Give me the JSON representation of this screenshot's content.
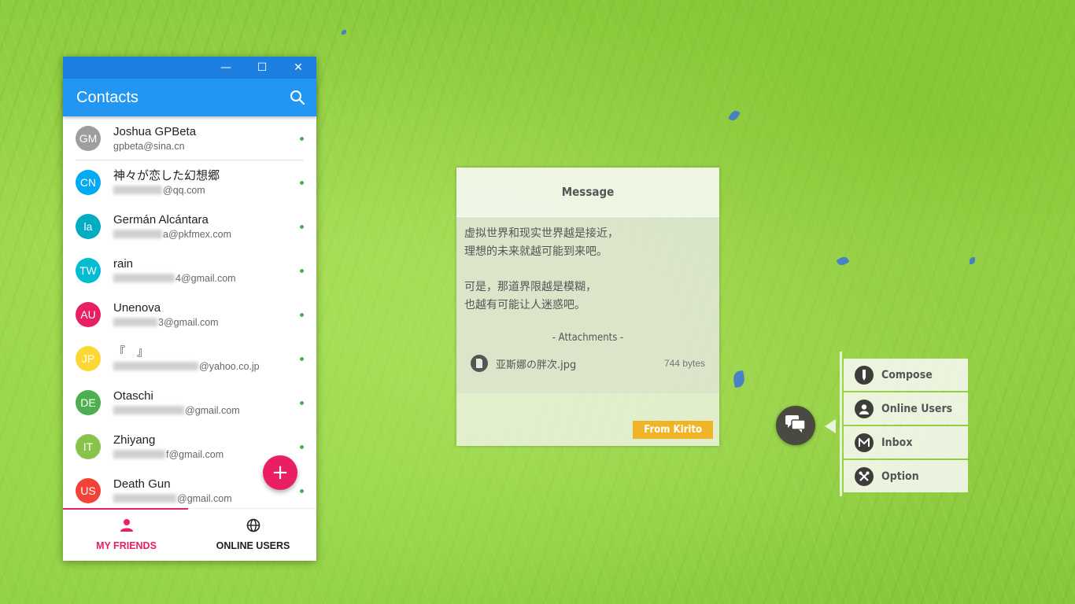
{
  "contacts_window": {
    "window_controls": {
      "minimize": "—",
      "maximize": "☐",
      "close": "✕"
    },
    "title": "Contacts",
    "contacts": [
      {
        "initials": "GM",
        "name": "Joshua GPBeta",
        "email": "gpbeta@sina.cn",
        "color": "#9e9e9e",
        "online": true
      },
      {
        "initials": "CN",
        "name": "神々が恋した幻想郷",
        "email": "@qq.com",
        "color": "#03a9f4",
        "online": true
      },
      {
        "initials": "la",
        "name": "Germán Alcántara",
        "email": "a@pkfmex.com",
        "color": "#00acc1",
        "online": true
      },
      {
        "initials": "TW",
        "name": "rain",
        "email": "4@gmail.com",
        "color": "#00bcd4",
        "online": true
      },
      {
        "initials": "AU",
        "name": "Unenova",
        "email": "3@gmail.com",
        "color": "#e91e63",
        "online": true
      },
      {
        "initials": "JP",
        "name": "『　』",
        "email": "@yahoo.co.jp",
        "color": "#fdd835",
        "online": true
      },
      {
        "initials": "DE",
        "name": "Otaschi",
        "email": "@gmail.com",
        "color": "#4caf50",
        "online": true
      },
      {
        "initials": "IT",
        "name": "Zhiyang",
        "email": "f@gmail.com",
        "color": "#8bc34a",
        "online": true
      },
      {
        "initials": "US",
        "name": "Death Gun",
        "email": "@gmail.com",
        "color": "#f44336",
        "online": true
      }
    ],
    "fab_label": "+",
    "nav": [
      {
        "label": "MY FRIENDS",
        "icon": "person-icon",
        "active": true,
        "color": "#e91e63"
      },
      {
        "label": "ONLINE USERS",
        "icon": "globe-icon",
        "active": false,
        "color": "#222222"
      }
    ]
  },
  "message_card": {
    "title": "Message",
    "paragraphs": [
      [
        "虚拟世界和现实世界越是接近，",
        "理想的未来就越可能到来吧。"
      ],
      [
        "可是，那道界限越是模糊，",
        "也越有可能让人迷惑吧。"
      ]
    ],
    "attachments_title": "- Attachments -",
    "attachment": {
      "name": "亚斯娜の胖次.jpg",
      "size": "744 bytes"
    },
    "from": "From Kirito"
  },
  "chat_menu": {
    "items": [
      {
        "label": "Compose",
        "icon": "pencil-icon"
      },
      {
        "label": "Online Users",
        "icon": "user-icon"
      },
      {
        "label": "Inbox",
        "icon": "mail-icon"
      },
      {
        "label": "Option",
        "icon": "tools-icon"
      }
    ]
  },
  "colors": {
    "primary": "#2196f3",
    "titlebar": "#1d7fe0",
    "accent": "#e91e63",
    "badge": "#f0b429"
  }
}
